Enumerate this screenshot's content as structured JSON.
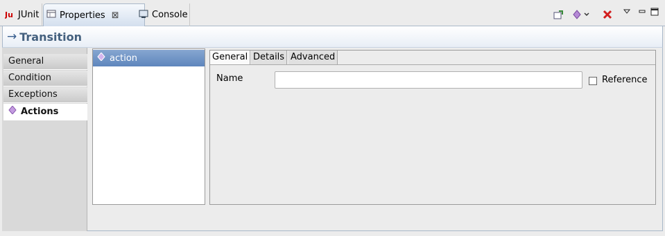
{
  "tabs": [
    {
      "label": "JUnit",
      "icon": "junit-icon"
    },
    {
      "label": "Properties",
      "icon": "properties-icon"
    },
    {
      "label": "Console",
      "icon": "console-icon"
    }
  ],
  "toolbar_icons": [
    "pin-icon",
    "new-element-dropdown-icon",
    "remove-icon",
    "view-menu-icon",
    "minimize-icon",
    "maximize-icon"
  ],
  "title": {
    "arrow": "→",
    "text": "Transition"
  },
  "sidebar": {
    "items": [
      {
        "label": "General"
      },
      {
        "label": "Condition"
      },
      {
        "label": "Exceptions"
      },
      {
        "label": "Actions"
      }
    ],
    "active": "Actions"
  },
  "list": {
    "items": [
      {
        "label": "action",
        "icon": "action-icon"
      }
    ]
  },
  "panel": {
    "tabs": [
      "General",
      "Details",
      "Advanced"
    ],
    "active_tab": "General",
    "name_label": "Name",
    "name_value": "",
    "reference_label": "Reference",
    "reference_checked": false
  },
  "colors": {
    "accent": "#385e8e",
    "selection": "#6e92c6",
    "title_text": "#44607e"
  }
}
